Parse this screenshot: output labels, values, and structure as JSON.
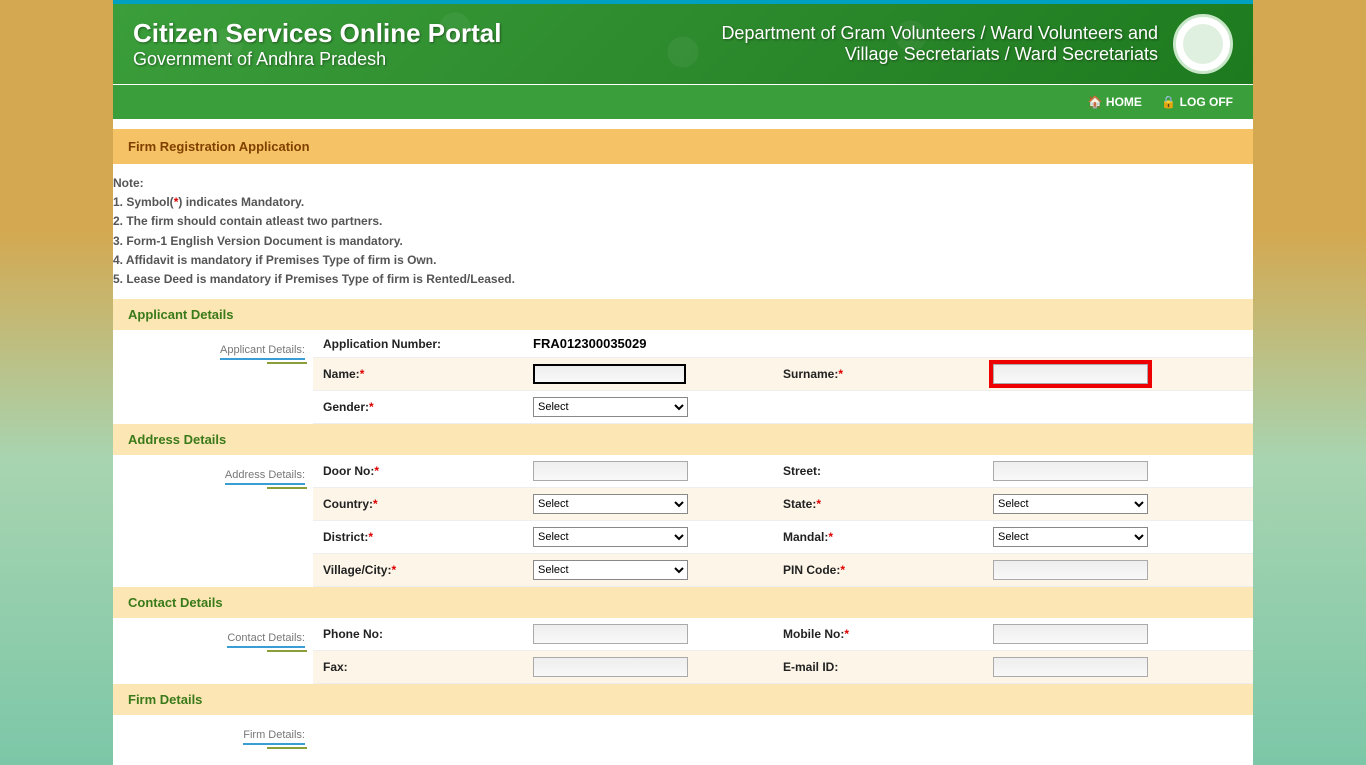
{
  "header": {
    "title": "Citizen Services Online Portal",
    "subtitle": "Government of Andhra Pradesh",
    "department": "Department of Gram Volunteers / Ward Volunteers and Village Secretariats / Ward Secretariats"
  },
  "nav": {
    "home": "HOME",
    "logoff": "LOG OFF"
  },
  "page_title": "Firm Registration Application",
  "notes": {
    "heading": "Note:",
    "line1a": "1. Symbol(",
    "line1b": "*",
    "line1c": ") indicates Mandatory.",
    "line2": "2. The firm should contain atleast two partners.",
    "line3": "3. Form-1 English Version Document is mandatory.",
    "line4": "4. Affidavit is mandatory if Premises Type of firm is Own.",
    "line5": "5. Lease Deed is mandatory if Premises Type of firm is Rented/Leased."
  },
  "sections": {
    "applicant": "Applicant Details",
    "applicant_side": "Applicant Details:",
    "address": "Address Details",
    "address_side": "Address Details:",
    "contact": "Contact Details",
    "contact_side": "Contact Details:",
    "firm": "Firm Details",
    "firm_side": "Firm Details:"
  },
  "fields": {
    "app_number_label": "Application Number:",
    "app_number_value": "FRA012300035029",
    "name_label": "Name:",
    "surname_label": "Surname:",
    "gender_label": "Gender:",
    "door_label": "Door No:",
    "street_label": "Street:",
    "country_label": "Country:",
    "state_label": "State:",
    "district_label": "District:",
    "mandal_label": "Mandal:",
    "village_label": "Village/City:",
    "pin_label": "PIN Code:",
    "phone_label": "Phone No:",
    "mobile_label": "Mobile No:",
    "fax_label": "Fax:",
    "email_label": "E-mail ID:",
    "select_default": "Select"
  }
}
